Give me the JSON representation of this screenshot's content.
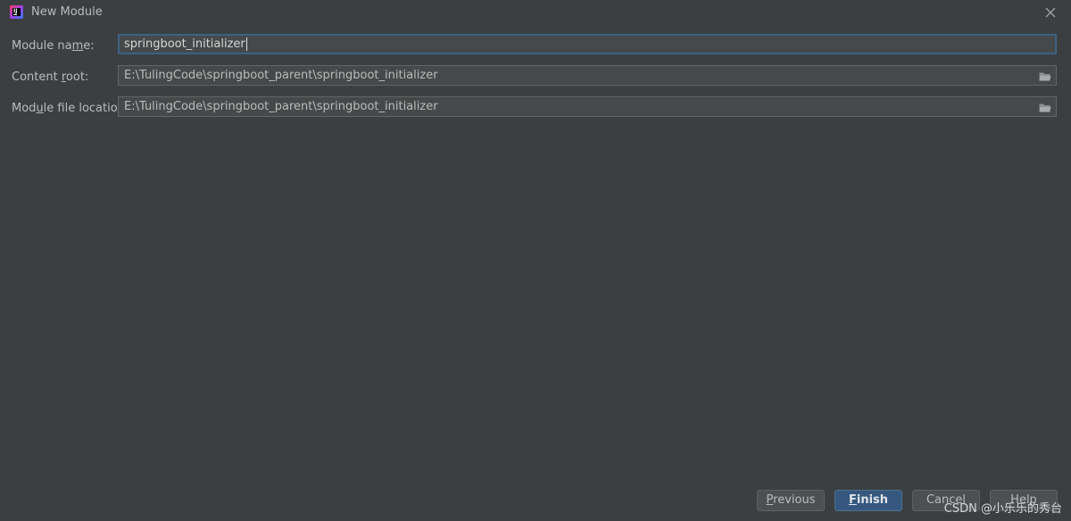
{
  "window": {
    "title": "New Module",
    "icon": "intellij-idea-icon",
    "close_icon": "close-icon"
  },
  "form": {
    "module_name": {
      "label_pre": "Module na",
      "label_mnemonic": "m",
      "label_post": "e:",
      "value": "springboot_initializer"
    },
    "content_root": {
      "label_pre": "Content ",
      "label_mnemonic": "r",
      "label_post": "oot:",
      "value": "E:\\TulingCode\\springboot_parent\\springboot_initializer",
      "browse_icon": "folder-open-icon"
    },
    "module_file_location": {
      "label_pre": "Mod",
      "label_mnemonic": "u",
      "label_post": "le file location:",
      "value": "E:\\TulingCode\\springboot_parent\\springboot_initializer",
      "browse_icon": "folder-open-icon"
    }
  },
  "buttons": {
    "previous": {
      "mnemonic": "P",
      "rest": "revious"
    },
    "finish": {
      "mnemonic": "F",
      "rest": "inish"
    },
    "cancel": {
      "label": "Cancel"
    },
    "help": {
      "label": "Help"
    }
  },
  "watermark": "CSDN @小乐乐的秀台",
  "colors": {
    "background": "#3c3f41",
    "field_background": "#45494a",
    "focus_border": "#3d6185",
    "primary_button": "#365880",
    "text": "#bbbbbb"
  }
}
